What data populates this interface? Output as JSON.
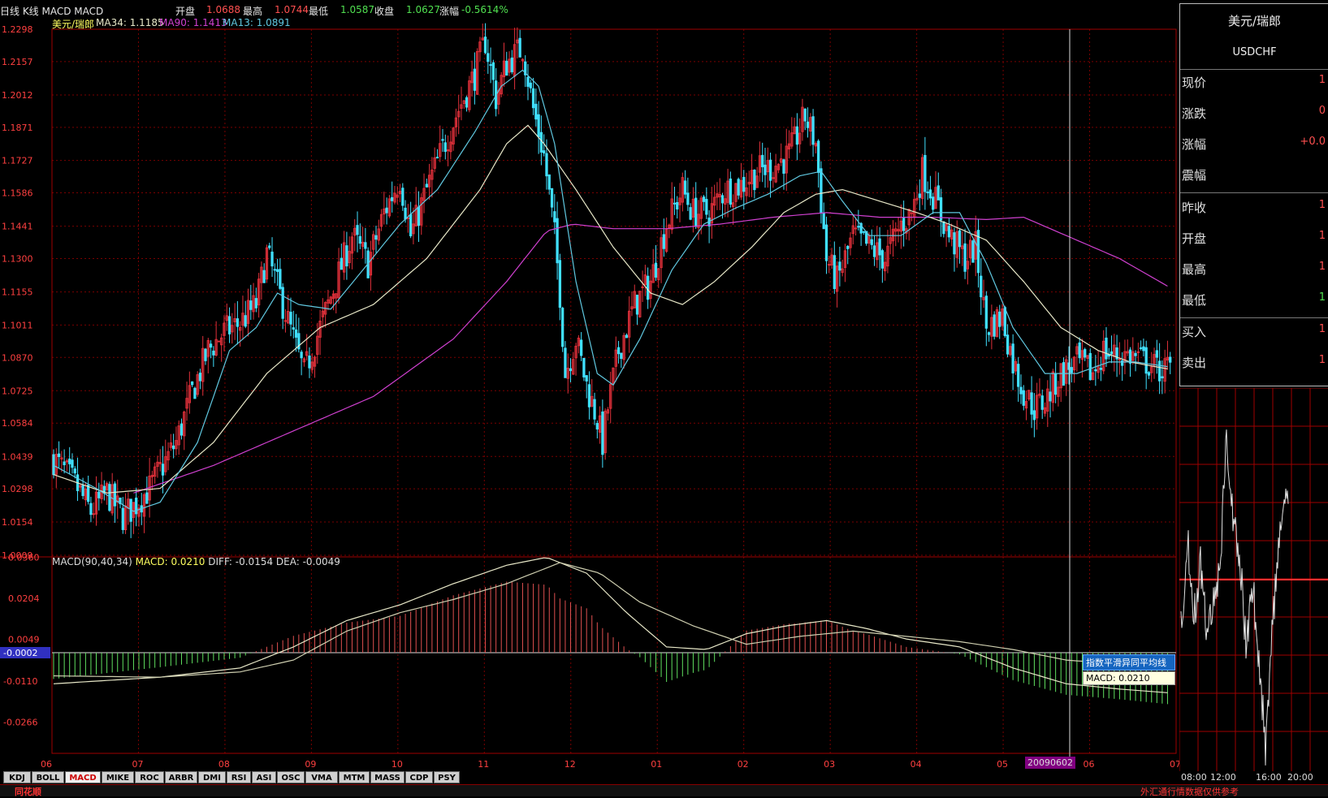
{
  "header": {
    "title": "日线 K线 MACD MACD",
    "open_label": "开盘",
    "open": "1.0688",
    "high_label": "最高",
    "high": "1.0744",
    "low_label": "最低",
    "low": "1.0587",
    "close_label": "收盘",
    "close": "1.0627",
    "change_label": "涨幅",
    "change": "-0.5614%"
  },
  "ma_legend": {
    "name": "美元/瑞郎",
    "ma34": "MA34: 1.1185",
    "ma90": "MA90: 1.1413",
    "ma13": "MA13: 1.0891"
  },
  "macd_legend": {
    "title": "MACD(90,40,34)",
    "macd": "MACD: 0.0210",
    "diff": "DIFF: -0.0154",
    "dea": "DEA: -0.0049"
  },
  "quote_panel": {
    "name": "美元/瑞郎",
    "code": "USDCHF",
    "rows": [
      {
        "label": "现价",
        "value": "1"
      },
      {
        "label": "涨跌",
        "value": "0"
      },
      {
        "label": "涨幅",
        "value": "+0.0"
      },
      {
        "label": "震幅",
        "value": ""
      },
      {
        "label": "昨收",
        "value": "1"
      },
      {
        "label": "开盘",
        "value": "1"
      },
      {
        "label": "最高",
        "value": "1"
      },
      {
        "label": "最低",
        "value": "1"
      },
      {
        "label": "买入",
        "value": "1"
      },
      {
        "label": "卖出",
        "value": "1"
      }
    ]
  },
  "tooltip": {
    "line1": "指数平滑异同平均线",
    "line2": "MACD: 0.0210"
  },
  "cursor_date": "20090602",
  "tabs": [
    "KDJ",
    "BOLL",
    "MACD",
    "MIKE",
    "ROC",
    "ARBR",
    "DMI",
    "RSI",
    "ASI",
    "OSC",
    "VMA",
    "MTM",
    "MASS",
    "CDP",
    "PSY"
  ],
  "active_tab": "MACD",
  "intraday_time_labels": [
    "08:00",
    "12:00",
    "16:00",
    "20:00"
  ],
  "status": {
    "brand": "同花顺",
    "disclaimer": "外汇通行情数据仅供参考"
  },
  "colors": {
    "up": "#e0303a",
    "down": "#40e0ff",
    "ma34": "#e8e8c8",
    "ma90": "#d040d0",
    "ma13": "#60c8e0",
    "grid": "#7a0000",
    "hist_up": "#e05050",
    "hist_down": "#60e060"
  },
  "chart_data": {
    "type": "candlestick",
    "x_tick_labels": [
      "06",
      "07",
      "08",
      "09",
      "10",
      "11",
      "12",
      "01",
      "02",
      "03",
      "04",
      "05",
      "06",
      "07"
    ],
    "y_ticks": [
      "1.2298",
      "1.2157",
      "1.2012",
      "1.1871",
      "1.1727",
      "1.1586",
      "1.1441",
      "1.1300",
      "1.1155",
      "1.1011",
      "1.0870",
      "1.0725",
      "1.0584",
      "1.0439",
      "1.0298",
      "1.0154",
      "1.0009"
    ],
    "ylim": [
      1.0009,
      1.2298
    ],
    "macd_ticks": [
      "0.0360",
      "0.0204",
      "0.0049",
      "-0.0002",
      "-0.0110",
      "-0.0266"
    ],
    "macd_ylim": [
      -0.037,
      0.037
    ],
    "close_keypoints": [
      [
        0,
        1.043
      ],
      [
        8,
        1.032
      ],
      [
        14,
        1.02
      ],
      [
        20,
        1.028
      ],
      [
        26,
        1.018
      ],
      [
        30,
        1.022
      ],
      [
        36,
        1.03
      ],
      [
        40,
        1.038
      ],
      [
        46,
        1.05
      ],
      [
        52,
        1.072
      ],
      [
        58,
        1.09
      ],
      [
        64,
        1.098
      ],
      [
        70,
        1.102
      ],
      [
        76,
        1.11
      ],
      [
        80,
        1.132
      ],
      [
        84,
        1.118
      ],
      [
        90,
        1.095
      ],
      [
        94,
        1.08
      ],
      [
        100,
        1.1
      ],
      [
        106,
        1.12
      ],
      [
        112,
        1.14
      ],
      [
        118,
        1.128
      ],
      [
        124,
        1.15
      ],
      [
        130,
        1.165
      ],
      [
        134,
        1.14
      ],
      [
        140,
        1.16
      ],
      [
        146,
        1.178
      ],
      [
        152,
        1.195
      ],
      [
        158,
        1.21
      ],
      [
        162,
        1.225
      ],
      [
        166,
        1.2
      ],
      [
        170,
        1.215
      ],
      [
        176,
        1.222
      ],
      [
        180,
        1.195
      ],
      [
        184,
        1.175
      ],
      [
        188,
        1.14
      ],
      [
        190,
        1.115
      ],
      [
        192,
        1.08
      ],
      [
        196,
        1.095
      ],
      [
        200,
        1.075
      ],
      [
        204,
        1.06
      ],
      [
        206,
        1.05
      ],
      [
        208,
        1.065
      ],
      [
        212,
        1.09
      ],
      [
        218,
        1.11
      ],
      [
        224,
        1.12
      ],
      [
        230,
        1.145
      ],
      [
        236,
        1.16
      ],
      [
        240,
        1.15
      ],
      [
        246,
        1.15
      ],
      [
        252,
        1.16
      ],
      [
        258,
        1.162
      ],
      [
        264,
        1.168
      ],
      [
        270,
        1.17
      ],
      [
        276,
        1.175
      ],
      [
        282,
        1.192
      ],
      [
        286,
        1.18
      ],
      [
        290,
        1.13
      ],
      [
        294,
        1.12
      ],
      [
        300,
        1.14
      ],
      [
        306,
        1.135
      ],
      [
        312,
        1.13
      ],
      [
        318,
        1.145
      ],
      [
        322,
        1.15
      ],
      [
        326,
        1.168
      ],
      [
        330,
        1.158
      ],
      [
        336,
        1.14
      ],
      [
        342,
        1.13
      ],
      [
        346,
        1.135
      ],
      [
        350,
        1.1
      ],
      [
        356,
        1.105
      ],
      [
        360,
        1.085
      ],
      [
        364,
        1.072
      ],
      [
        368,
        1.065
      ],
      [
        372,
        1.068
      ],
      [
        378,
        1.08
      ],
      [
        384,
        1.085
      ],
      [
        390,
        1.08
      ],
      [
        394,
        1.09
      ],
      [
        398,
        1.088
      ],
      [
        404,
        1.088
      ],
      [
        410,
        1.085
      ],
      [
        414,
        1.082
      ],
      [
        418,
        1.082
      ]
    ],
    "ma34_keypoints": [
      [
        0,
        1.036
      ],
      [
        20,
        1.028
      ],
      [
        40,
        1.03
      ],
      [
        60,
        1.05
      ],
      [
        80,
        1.08
      ],
      [
        100,
        1.1
      ],
      [
        120,
        1.11
      ],
      [
        140,
        1.13
      ],
      [
        160,
        1.16
      ],
      [
        170,
        1.18
      ],
      [
        178,
        1.188
      ],
      [
        184,
        1.18
      ],
      [
        196,
        1.16
      ],
      [
        210,
        1.135
      ],
      [
        224,
        1.115
      ],
      [
        236,
        1.11
      ],
      [
        248,
        1.12
      ],
      [
        262,
        1.135
      ],
      [
        274,
        1.15
      ],
      [
        286,
        1.158
      ],
      [
        296,
        1.16
      ],
      [
        310,
        1.155
      ],
      [
        324,
        1.15
      ],
      [
        336,
        1.145
      ],
      [
        350,
        1.138
      ],
      [
        364,
        1.12
      ],
      [
        378,
        1.1
      ],
      [
        392,
        1.09
      ],
      [
        404,
        1.085
      ],
      [
        418,
        1.082
      ]
    ],
    "ma90_keypoints": [
      [
        30,
        1.028
      ],
      [
        60,
        1.04
      ],
      [
        90,
        1.055
      ],
      [
        120,
        1.07
      ],
      [
        150,
        1.095
      ],
      [
        170,
        1.12
      ],
      [
        185,
        1.142
      ],
      [
        195,
        1.145
      ],
      [
        210,
        1.143
      ],
      [
        230,
        1.143
      ],
      [
        250,
        1.145
      ],
      [
        270,
        1.148
      ],
      [
        290,
        1.15
      ],
      [
        310,
        1.148
      ],
      [
        330,
        1.148
      ],
      [
        350,
        1.147
      ],
      [
        364,
        1.148
      ],
      [
        380,
        1.14
      ],
      [
        400,
        1.13
      ],
      [
        418,
        1.118
      ]
    ],
    "ma13_keypoints": [
      [
        0,
        1.04
      ],
      [
        16,
        1.03
      ],
      [
        30,
        1.02
      ],
      [
        40,
        1.024
      ],
      [
        54,
        1.05
      ],
      [
        66,
        1.09
      ],
      [
        76,
        1.1
      ],
      [
        84,
        1.115
      ],
      [
        92,
        1.11
      ],
      [
        104,
        1.108
      ],
      [
        116,
        1.125
      ],
      [
        130,
        1.145
      ],
      [
        144,
        1.16
      ],
      [
        158,
        1.185
      ],
      [
        168,
        1.205
      ],
      [
        176,
        1.212
      ],
      [
        182,
        1.205
      ],
      [
        188,
        1.18
      ],
      [
        196,
        1.12
      ],
      [
        204,
        1.08
      ],
      [
        210,
        1.075
      ],
      [
        220,
        1.095
      ],
      [
        232,
        1.125
      ],
      [
        244,
        1.145
      ],
      [
        256,
        1.152
      ],
      [
        268,
        1.158
      ],
      [
        280,
        1.166
      ],
      [
        288,
        1.168
      ],
      [
        296,
        1.155
      ],
      [
        306,
        1.14
      ],
      [
        318,
        1.14
      ],
      [
        330,
        1.15
      ],
      [
        340,
        1.15
      ],
      [
        350,
        1.128
      ],
      [
        360,
        1.1
      ],
      [
        372,
        1.08
      ],
      [
        384,
        1.08
      ],
      [
        396,
        1.085
      ],
      [
        406,
        1.085
      ],
      [
        418,
        1.083
      ]
    ],
    "macd_diff_keypoints": [
      [
        0,
        -0.012
      ],
      [
        40,
        -0.0095
      ],
      [
        70,
        -0.006
      ],
      [
        90,
        0.002
      ],
      [
        110,
        0.012
      ],
      [
        130,
        0.018
      ],
      [
        150,
        0.026
      ],
      [
        170,
        0.033
      ],
      [
        185,
        0.036
      ],
      [
        200,
        0.03
      ],
      [
        215,
        0.015
      ],
      [
        230,
        0.002
      ],
      [
        245,
        0.001
      ],
      [
        260,
        0.007
      ],
      [
        275,
        0.01
      ],
      [
        290,
        0.012
      ],
      [
        305,
        0.009
      ],
      [
        320,
        0.005
      ],
      [
        340,
        0.002
      ],
      [
        360,
        -0.006
      ],
      [
        380,
        -0.012
      ],
      [
        400,
        -0.014
      ],
      [
        418,
        -0.0154
      ]
    ],
    "macd_dea_keypoints": [
      [
        0,
        -0.009
      ],
      [
        40,
        -0.0095
      ],
      [
        70,
        -0.0075
      ],
      [
        90,
        -0.003
      ],
      [
        110,
        0.008
      ],
      [
        130,
        0.015
      ],
      [
        150,
        0.02
      ],
      [
        170,
        0.026
      ],
      [
        190,
        0.034
      ],
      [
        205,
        0.03
      ],
      [
        220,
        0.019
      ],
      [
        240,
        0.01
      ],
      [
        260,
        0.003
      ],
      [
        280,
        0.006
      ],
      [
        300,
        0.008
      ],
      [
        320,
        0.006
      ],
      [
        340,
        0.004
      ],
      [
        360,
        0.001
      ],
      [
        380,
        -0.003
      ],
      [
        400,
        -0.0045
      ],
      [
        418,
        -0.0049
      ]
    ]
  }
}
